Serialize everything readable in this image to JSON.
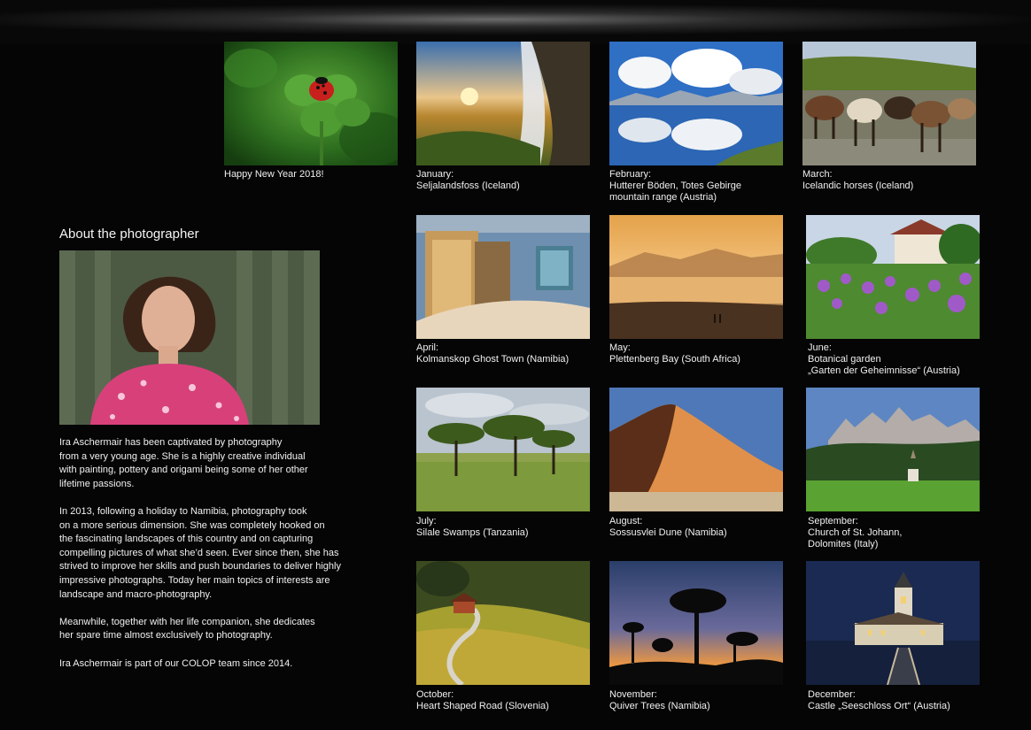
{
  "header": {
    "caption": "Happy New Year 2018!"
  },
  "about": {
    "title": "About  the photographer",
    "paragraphs": [
      "Ira Aschermair has been captivated by photography\nfrom a very young age. She is a highly creative individual\nwith painting, pottery and origami being some of her other\nlifetime passions.",
      "In 2013, following a holiday to Namibia, photography took\non a more serious dimension. She was completely hooked on\nthe fascinating landscapes of this country and on capturing\ncompelling pictures of what she’d seen. Ever since then, she has\nstrived to improve her skills and push boundaries to deliver highly\nimpressive photographs. Today her main topics of interests are\n landscape and macro-photography.",
      "Meanwhile, together with her life companion, she dedicates\nher spare time almost exclusively to photography.",
      "Ira Aschermair is part of our COLOP team since 2014."
    ]
  },
  "months": [
    {
      "month": "January:",
      "lines": [
        "Seljalandsfoss (Iceland)"
      ]
    },
    {
      "month": "February:",
      "lines": [
        "Hutterer Böden, Totes Gebirge",
        "mountain range (Austria)"
      ]
    },
    {
      "month": "March:",
      "lines": [
        "Icelandic horses (Iceland)"
      ]
    },
    {
      "month": "April:",
      "lines": [
        "Kolmanskop Ghost Town (Namibia)"
      ]
    },
    {
      "month": "May:",
      "lines": [
        "Plettenberg Bay (South Africa)"
      ]
    },
    {
      "month": "June:",
      "lines": [
        "Botanical garden",
        "„Garten der Geheimnisse“ (Austria)"
      ]
    },
    {
      "month": "July:",
      "lines": [
        "Silale Swamps (Tanzania)"
      ]
    },
    {
      "month": "August:",
      "lines": [
        "Sossusvlei Dune (Namibia)"
      ]
    },
    {
      "month": "September:",
      "lines": [
        "Church of St. Johann,",
        "Dolomites (Italy)"
      ]
    },
    {
      "month": "October:",
      "lines": [
        "Heart Shaped Road (Slovenia)"
      ]
    },
    {
      "month": "November:",
      "lines": [
        "Quiver Trees (Namibia)"
      ]
    },
    {
      "month": "December:",
      "lines": [
        "Castle „Seeschloss Ort“ (Austria)"
      ]
    }
  ]
}
